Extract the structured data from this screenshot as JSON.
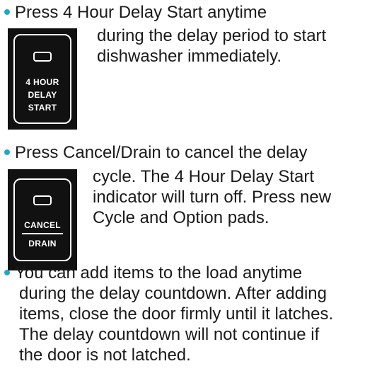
{
  "colors": {
    "bullet": "#1fa9c8",
    "text": "#1a1a1a",
    "key_background": "#111111"
  },
  "section1": {
    "bullet_text": "Press 4 Hour Delay Start anytime",
    "continuation": [
      "during the delay period to start",
      "dishwasher immediately."
    ],
    "key_label_lines": [
      "4 HOUR",
      "DELAY",
      "START"
    ]
  },
  "section2": {
    "bullet_text": "Press Cancel/Drain to cancel the delay",
    "continuation": [
      "cycle. The 4 Hour Delay Start",
      "indicator will turn off. Press new",
      "Cycle and Option pads."
    ],
    "key_label_top": "CANCEL",
    "key_label_bottom": "DRAIN"
  },
  "section3": {
    "lines": [
      "You can add items to the load anytime",
      "during the delay countdown. After adding",
      "items, close the door firmly until it latches.",
      "The delay countdown will not continue if",
      "the door is not latched."
    ]
  }
}
